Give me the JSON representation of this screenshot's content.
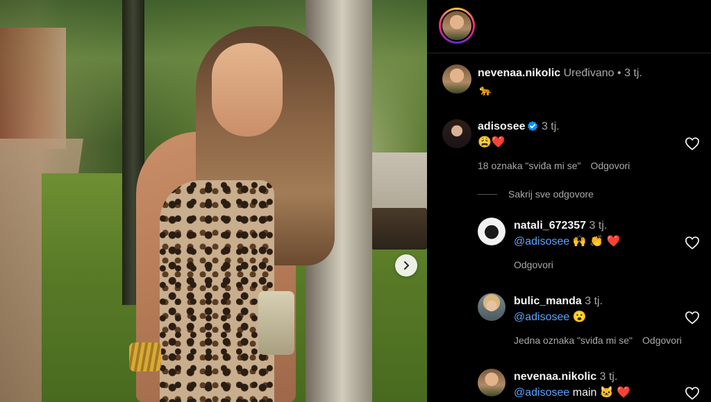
{
  "post": {
    "next_button_icon": "chevron-right-icon"
  },
  "header": {
    "avatar_icon": "profile-avatar"
  },
  "caption": {
    "username": "nevenaa.nikolic",
    "edited": "Uređivano",
    "separator": "•",
    "time": "3 tj.",
    "text": "🐆"
  },
  "comments": [
    {
      "username": "adisosee",
      "verified": true,
      "time": "3 tj.",
      "text": "😩❤️",
      "likes": "18 oznaka \"sviđa mi se\"",
      "reply_label": "Odgovori",
      "hide_replies": "Sakrij sve odgovore",
      "replies": [
        {
          "username": "natali_672357",
          "time": "3 tj.",
          "mention": "@adisosee",
          "text": " 🙌 👏 ❤️",
          "reply_label": "Odgovori"
        },
        {
          "username": "bulic_manda",
          "time": "3 tj.",
          "mention": "@adisosee",
          "text": " 😮",
          "likes": "Jedna oznaka \"sviđa mi se\"",
          "reply_label": "Odgovori"
        },
        {
          "username": "nevenaa.nikolic",
          "time": "3 tj.",
          "mention": "@adisosee",
          "text": " main 🐱 ❤️"
        }
      ]
    }
  ],
  "colors": {
    "background": "#000000",
    "text": "#f5f5f5",
    "muted": "#a8a8a8",
    "mention": "#58a6ff",
    "verified": "#0095f6",
    "divider": "#262626"
  }
}
